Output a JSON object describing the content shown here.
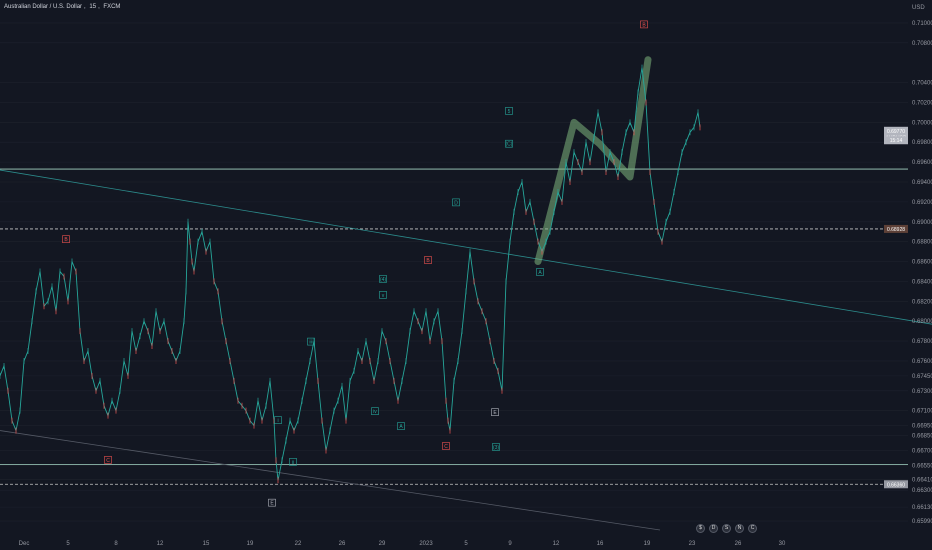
{
  "header": {
    "symbol_title": "Australian Dollar / U.S. Dollar",
    "interval": "15",
    "exchange": "FXCM",
    "separator": ","
  },
  "chart_data": {
    "type": "line",
    "title": "Australian Dollar / U.S. Dollar, 15, FXCM",
    "xlabel": "",
    "ylabel": "",
    "currency_label": "USD",
    "ylim": [
      0.659,
      0.7115
    ],
    "x_ticks": [
      "Dec",
      "5",
      "8",
      "12",
      "15",
      "19",
      "22",
      "26",
      "29",
      "2023",
      "5",
      "9",
      "12",
      "16",
      "19",
      "23",
      "26",
      "30"
    ],
    "y_ticks": [
      "0.71000",
      "0.70800",
      "0.70400",
      "0.70200",
      "0.70000",
      "0.69800",
      "0.69600",
      "0.69400",
      "0.69200",
      "0.69000",
      "0.68800",
      "0.68600",
      "0.68400",
      "0.68200",
      "0.68000",
      "0.67800",
      "0.67600",
      "0.67450",
      "0.67300",
      "0.67100",
      "0.66950",
      "0.66850",
      "0.66700",
      "0.66550",
      "0.66410",
      "0.66300",
      "0.66130",
      "0.65990"
    ],
    "y_tick_values": [
      0.71,
      0.708,
      0.704,
      0.702,
      0.7,
      0.698,
      0.696,
      0.694,
      0.692,
      0.69,
      0.688,
      0.686,
      0.684,
      0.682,
      0.68,
      0.678,
      0.676,
      0.6745,
      0.673,
      0.671,
      0.6695,
      0.6685,
      0.667,
      0.6655,
      0.6641,
      0.663,
      0.6613,
      0.6599
    ],
    "series": [
      {
        "name": "AUDUSD",
        "color": "#26a69a",
        "x": [
          0,
          4,
          8,
          12,
          16,
          20,
          24,
          28,
          32,
          36,
          40,
          44,
          48,
          52,
          56,
          60,
          64,
          68,
          72,
          76,
          80,
          84,
          88,
          92,
          96,
          100,
          104,
          108,
          112,
          116,
          120,
          124,
          128,
          132,
          136,
          140,
          144,
          148,
          152,
          156,
          160,
          164,
          168,
          172,
          176,
          180,
          184,
          186,
          188,
          190,
          192,
          194,
          198,
          202,
          206,
          210,
          214,
          218,
          222,
          226,
          230,
          234,
          238,
          242,
          246,
          250,
          254,
          258,
          262,
          266,
          270,
          274,
          276,
          278,
          282,
          286,
          290,
          294,
          298,
          302,
          306,
          310,
          314,
          318,
          322,
          326,
          330,
          334,
          338,
          342,
          346,
          350,
          354,
          358,
          362,
          366,
          370,
          374,
          378,
          382,
          386,
          390,
          394,
          398,
          402,
          406,
          410,
          414,
          418,
          422,
          426,
          430,
          434,
          438,
          442,
          446,
          448,
          450,
          454,
          458,
          462,
          466,
          470,
          474,
          478,
          482,
          486,
          490,
          494,
          498,
          502,
          506,
          510,
          514,
          518,
          522,
          526,
          530,
          534,
          538,
          542,
          546,
          550,
          554,
          558,
          562,
          566,
          570,
          574,
          578,
          582,
          586,
          590,
          594,
          598,
          602,
          606,
          610,
          614,
          618,
          622,
          626,
          630,
          634,
          638,
          642,
          646,
          650,
          654,
          658,
          662,
          666,
          670,
          674,
          678,
          682,
          686,
          690,
          694,
          698,
          700
        ],
        "y": [
          0.6745,
          0.6755,
          0.673,
          0.67,
          0.669,
          0.671,
          0.676,
          0.677,
          0.68,
          0.683,
          0.685,
          0.6815,
          0.682,
          0.6835,
          0.681,
          0.685,
          0.6845,
          0.682,
          0.686,
          0.685,
          0.679,
          0.676,
          0.677,
          0.6745,
          0.673,
          0.674,
          0.6715,
          0.6705,
          0.672,
          0.671,
          0.673,
          0.676,
          0.6745,
          0.679,
          0.677,
          0.6785,
          0.68,
          0.679,
          0.6775,
          0.681,
          0.679,
          0.68,
          0.678,
          0.677,
          0.676,
          0.677,
          0.68,
          0.683,
          0.69,
          0.688,
          0.686,
          0.685,
          0.688,
          0.689,
          0.687,
          0.688,
          0.684,
          0.683,
          0.68,
          0.678,
          0.676,
          0.674,
          0.672,
          0.6715,
          0.671,
          0.67,
          0.6695,
          0.672,
          0.67,
          0.6715,
          0.674,
          0.67,
          0.666,
          0.664,
          0.666,
          0.668,
          0.67,
          0.669,
          0.67,
          0.672,
          0.674,
          0.676,
          0.678,
          0.674,
          0.67,
          0.667,
          0.669,
          0.671,
          0.672,
          0.6735,
          0.67,
          0.674,
          0.675,
          0.677,
          0.676,
          0.678,
          0.676,
          0.674,
          0.676,
          0.679,
          0.678,
          0.676,
          0.674,
          0.672,
          0.674,
          0.676,
          0.679,
          0.681,
          0.68,
          0.679,
          0.681,
          0.678,
          0.68,
          0.681,
          0.678,
          0.672,
          0.67,
          0.669,
          0.674,
          0.676,
          0.679,
          0.683,
          0.687,
          0.684,
          0.682,
          0.681,
          0.68,
          0.678,
          0.676,
          0.675,
          0.673,
          0.684,
          0.688,
          0.691,
          0.693,
          0.694,
          0.691,
          0.692,
          0.69,
          0.688,
          0.687,
          0.688,
          0.689,
          0.691,
          0.693,
          0.692,
          0.696,
          0.694,
          0.697,
          0.696,
          0.695,
          0.698,
          0.696,
          0.6985,
          0.701,
          0.699,
          0.695,
          0.697,
          0.696,
          0.6945,
          0.697,
          0.699,
          0.7,
          0.699,
          0.703,
          0.7055,
          0.702,
          0.695,
          0.692,
          0.689,
          0.688,
          0.69,
          0.691,
          0.693,
          0.695,
          0.697,
          0.698,
          0.699,
          0.6995,
          0.701,
          0.6995
        ]
      }
    ],
    "horizontal_levels": [
      {
        "value": 0.6953,
        "style": "solid",
        "color": "#a5d6c4"
      },
      {
        "value": 0.68928,
        "style": "dashed",
        "color": "#c8c8c8"
      },
      {
        "value": 0.6656,
        "style": "solid",
        "color": "#a5d6c4"
      },
      {
        "value": 0.6636,
        "style": "dashed",
        "color": "#c8c8c8"
      }
    ],
    "price_tags": [
      {
        "label": "AUDUSD",
        "value": 0.6985,
        "color": "#b2b5be"
      },
      {
        "label": "0.69770",
        "value": 0.69915,
        "color": "#b2b5be"
      },
      {
        "label": "15:14",
        "value": 0.6982,
        "color": "#b2b5be"
      },
      {
        "label": "0.68928",
        "value": 0.68928,
        "color": "#5d4037"
      },
      {
        "label": "0.66360",
        "value": 0.6636,
        "color": "#9598a1"
      }
    ],
    "annotations": [
      {
        "text": "B",
        "color": "#ef5350",
        "x_index": 66,
        "value": 0.6882
      },
      {
        "text": "C",
        "color": "#ef5350",
        "x_index": 108,
        "value": 0.666
      },
      {
        "text": "B",
        "color": "#ef5350",
        "x_index": 428,
        "value": 0.6861
      },
      {
        "text": "C",
        "color": "#ef5350",
        "x_index": 446,
        "value": 0.6674
      },
      {
        "text": "B",
        "color": "#ef5350",
        "x_index": 644,
        "value": 0.7098
      },
      {
        "text": "5",
        "color": "#26a69a",
        "x_index": 509,
        "value": 0.7011
      },
      {
        "text": "(C)",
        "color": "#26a69a",
        "x_index": 509,
        "value": 0.6978
      },
      {
        "text": "D",
        "color": "#26a69a",
        "x_index": 456,
        "value": 0.6919
      },
      {
        "text": "(4)",
        "color": "#26a69a",
        "x_index": 383,
        "value": 0.6842
      },
      {
        "text": "v",
        "color": "#26a69a",
        "x_index": 383,
        "value": 0.6826
      },
      {
        "text": "iii",
        "color": "#26a69a",
        "x_index": 311,
        "value": 0.6779
      },
      {
        "text": "iv",
        "color": "#26a69a",
        "x_index": 375,
        "value": 0.6709
      },
      {
        "text": "A",
        "color": "#26a69a",
        "x_index": 401,
        "value": 0.6694
      },
      {
        "text": "ii",
        "color": "#26a69a",
        "x_index": 293,
        "value": 0.6658
      },
      {
        "text": "i",
        "color": "#26a69a",
        "x_index": 278,
        "value": 0.67
      },
      {
        "text": "(3)",
        "color": "#26a69a",
        "x_index": 496,
        "value": 0.6673
      },
      {
        "text": "E",
        "color": "#b2b5be",
        "x_index": 495,
        "value": 0.6708
      },
      {
        "text": "A",
        "color": "#26a69a",
        "x_index": 540,
        "value": 0.6849
      },
      {
        "text": "E",
        "color": "#b2b5be",
        "x_index": 272,
        "value": 0.6617
      }
    ],
    "trendlines": [
      {
        "from": [
          0,
          0.6952
        ],
        "to": [
          932,
          0.6797
        ],
        "color": "#2c8c8c"
      },
      {
        "from": [
          0,
          0.669
        ],
        "to": [
          660,
          0.659
        ],
        "color": "#555a66"
      }
    ],
    "highlight_path": {
      "color": "#7fb77e",
      "points": [
        [
          538,
          0.686
        ],
        [
          574,
          0.7
        ],
        [
          600,
          0.6978
        ],
        [
          630,
          0.6945
        ],
        [
          648,
          0.7063
        ]
      ]
    },
    "grid": true,
    "legend": "none"
  },
  "events": {
    "items": [
      "earnings-icon",
      "dividends-icon",
      "split-icon",
      "news-icon",
      "calendar-icon"
    ],
    "labels": [
      "$",
      "D",
      "S",
      "N",
      "C"
    ]
  }
}
